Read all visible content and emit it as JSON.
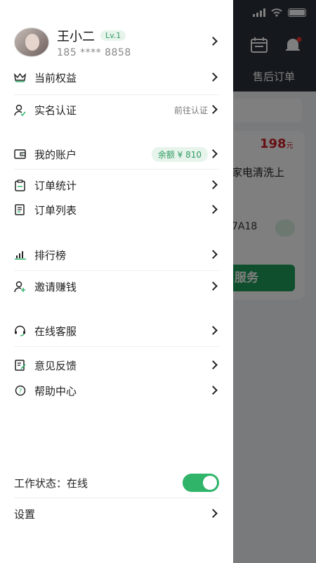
{
  "background": {
    "tab_label": "售后订单",
    "price": "198",
    "price_unit": "元",
    "line1": "家电清洗上",
    "line2": "7A18",
    "button_label": "服务"
  },
  "profile": {
    "name": "王小二",
    "level": "Lv.1",
    "phone": "185 **** 8858"
  },
  "menu": {
    "benefits": {
      "label": "当前权益"
    },
    "verify": {
      "label": "实名认证",
      "hint": "前往认证"
    },
    "account": {
      "label": "我的账户",
      "badge": "余额 ¥ 810"
    },
    "order_stats": {
      "label": "订单统计"
    },
    "order_list": {
      "label": "订单列表"
    },
    "ranking": {
      "label": "排行榜"
    },
    "invite": {
      "label": "邀请赚钱"
    },
    "service": {
      "label": "在线客服"
    },
    "feedback": {
      "label": "意见反馈"
    },
    "help": {
      "label": "帮助中心"
    }
  },
  "work_status": {
    "label": "工作状态：在线",
    "on": true
  },
  "settings": {
    "label": "设置"
  },
  "colors": {
    "accent": "#2fb46a",
    "badge_bg": "#e7f4ec",
    "price": "#d0202a"
  }
}
